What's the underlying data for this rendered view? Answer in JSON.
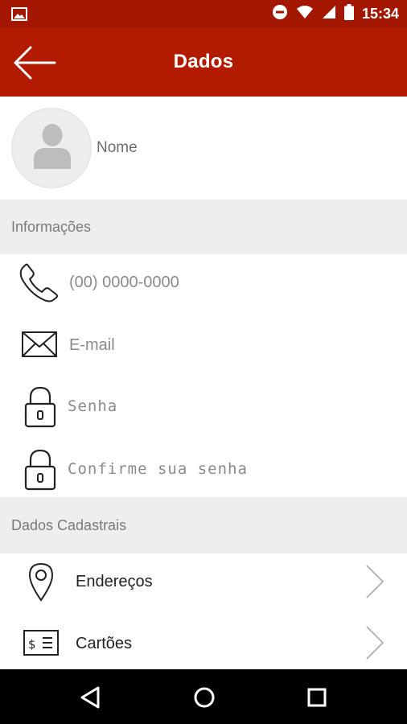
{
  "status_bar": {
    "time": "15:34",
    "icons": [
      "image-icon",
      "dnd-icon",
      "wifi-icon",
      "signal-icon",
      "battery-icon"
    ]
  },
  "app_bar": {
    "title": "Dados",
    "back_icon": "arrow-left-icon"
  },
  "profile": {
    "avatar_icon": "person-icon",
    "name_placeholder": "Nome"
  },
  "sections": {
    "info_header": "Informações",
    "register_header": "Dados Cadastrais"
  },
  "fields": {
    "phone_placeholder": "(00) 0000-0000",
    "email_placeholder": "E-mail",
    "password_placeholder": "Senha",
    "confirm_password_placeholder": "Confirme sua senha"
  },
  "links": {
    "addresses_label": "Endereços",
    "cards_label": "Cartões"
  },
  "nav_bar": {
    "icons": [
      "back-triangle-icon",
      "home-circle-icon",
      "recents-square-icon"
    ]
  },
  "colors": {
    "status_bar": "#a31700",
    "app_bar": "#b31b00",
    "section_bg": "#eeeeee"
  }
}
